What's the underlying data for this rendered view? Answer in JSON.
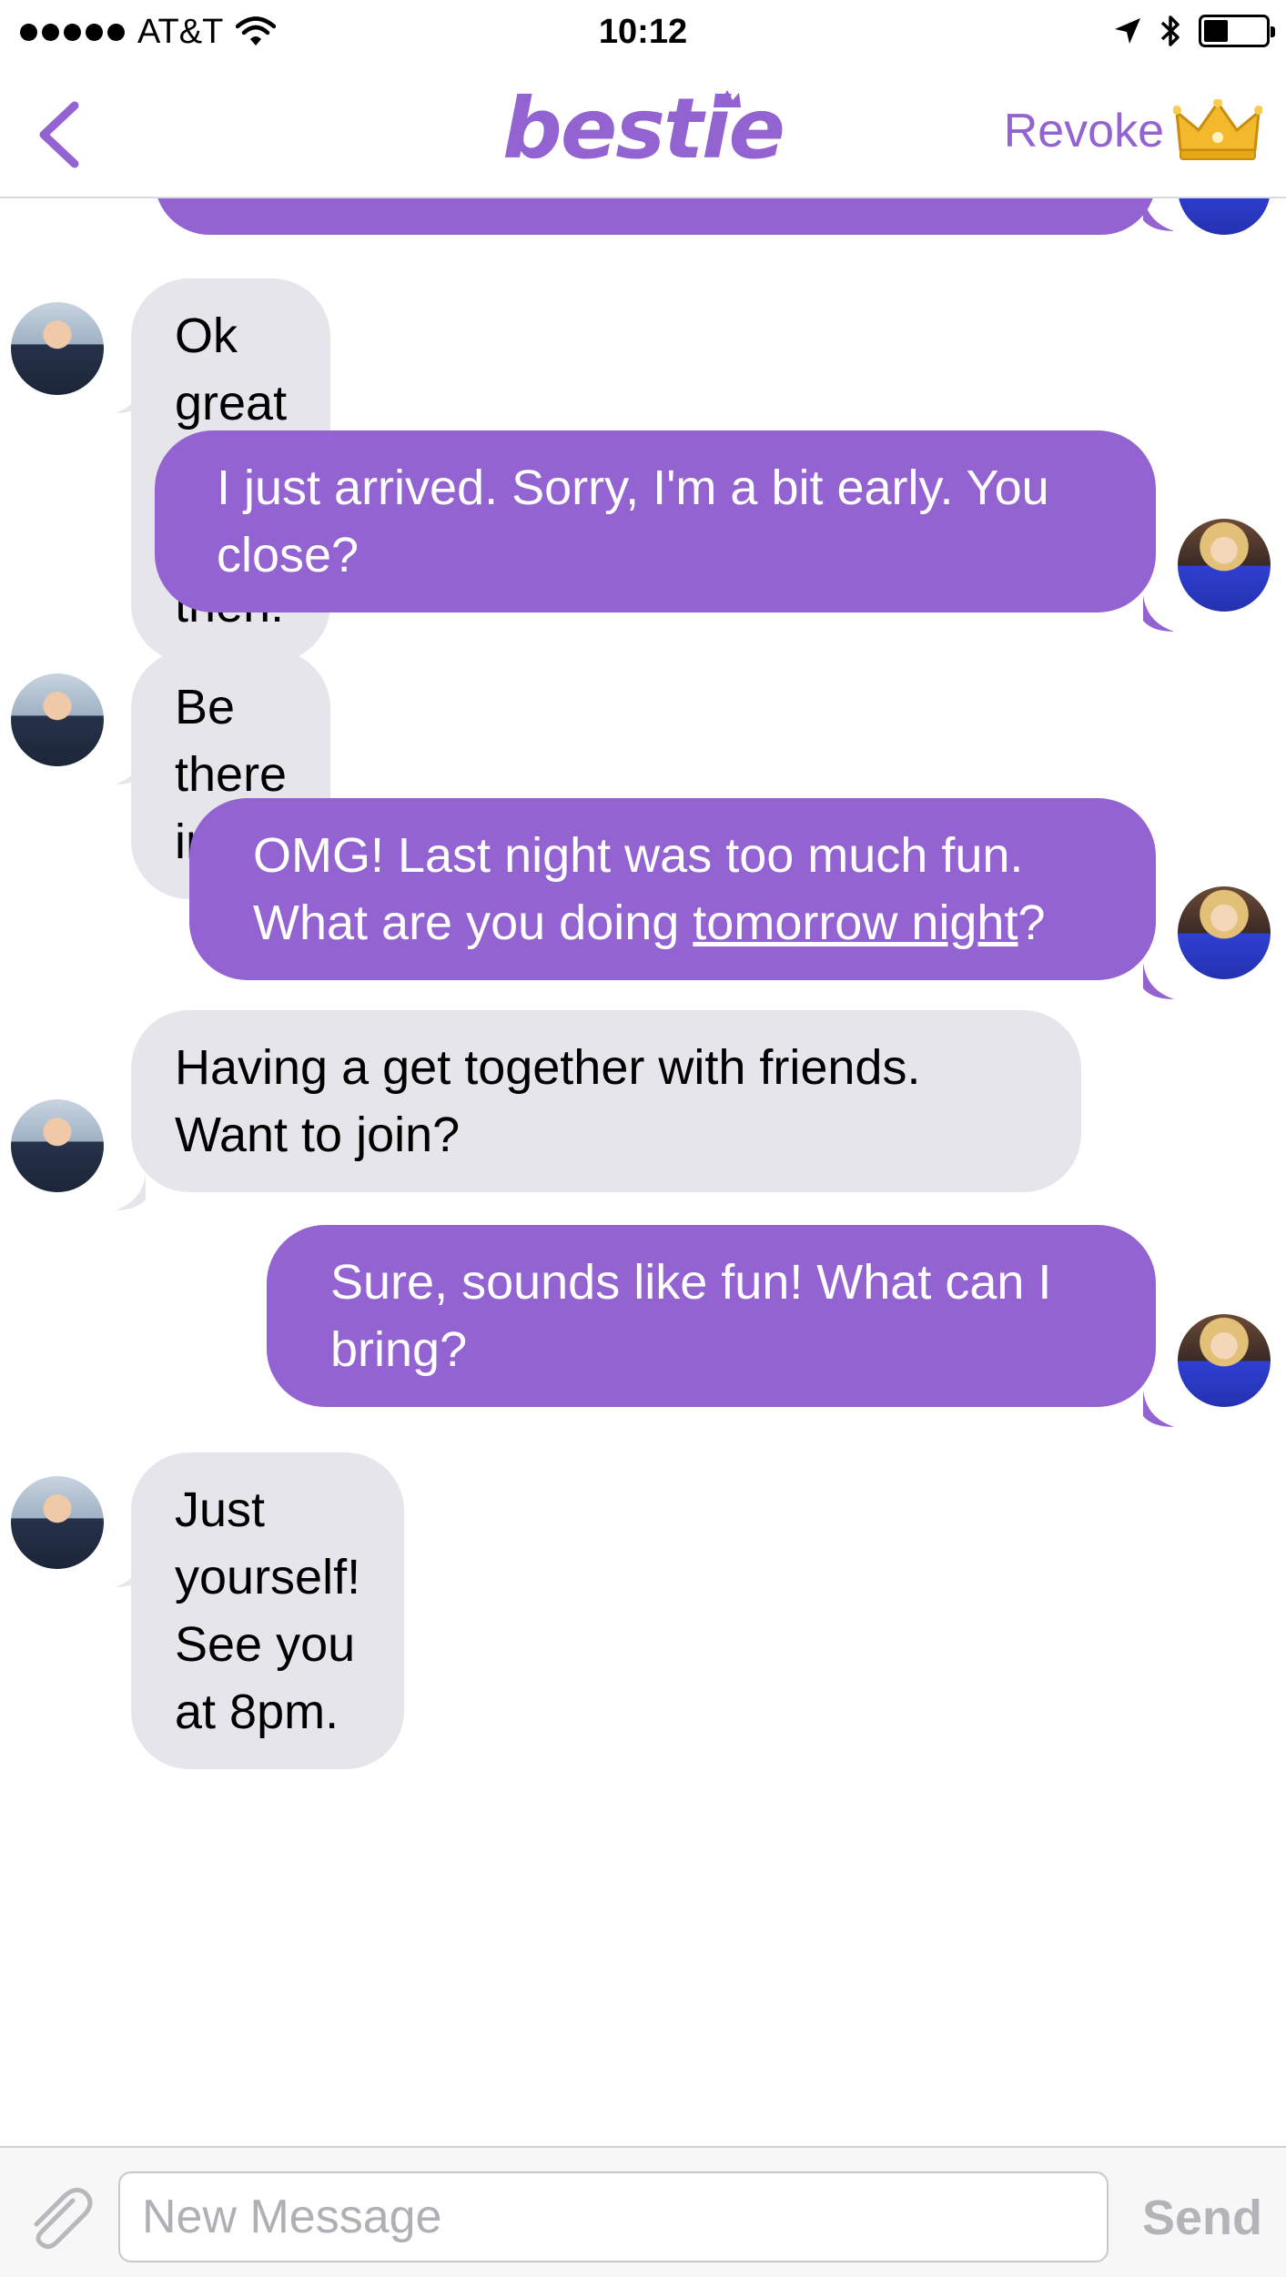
{
  "status_bar": {
    "carrier": "AT&T",
    "time": "10:12",
    "signal_bars": 5,
    "battery_level": 0.4
  },
  "nav": {
    "back_icon": "chevron-left-icon",
    "brand": "bestie",
    "revoke_label": "Revoke",
    "crown_icon": "crown-icon"
  },
  "messages": [
    {
      "from": "me",
      "text": ""
    },
    {
      "from": "them",
      "text": "Ok great see you then!"
    },
    {
      "from": "me",
      "text": "I just arrived. Sorry, I'm a bit early. You close?"
    },
    {
      "from": "them",
      "text": "Be there in 5."
    },
    {
      "from": "me",
      "text_before": "OMG! Last night was too much fun. What are you doing ",
      "link": "tomorrow night",
      "text_after": "?"
    },
    {
      "from": "them",
      "text": "Having a get together with friends. Want to join?"
    },
    {
      "from": "me",
      "text": "Sure, sounds like fun! What can I bring?"
    },
    {
      "from": "them",
      "text": "Just yourself! See you at 8pm."
    }
  ],
  "composer": {
    "attach_icon": "paperclip-icon",
    "placeholder": "New Message",
    "value": "",
    "send_label": "Send"
  },
  "colors": {
    "accent": "#9263d1",
    "incoming_bubble": "#e6e5eb",
    "outgoing_bubble": "#9263d1",
    "send_disabled": "#b4b4b8",
    "crown_gold": "#f2b92c"
  }
}
